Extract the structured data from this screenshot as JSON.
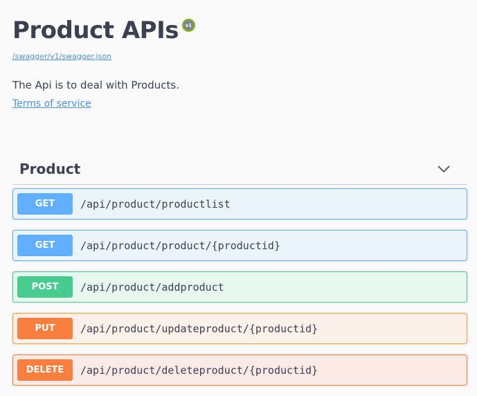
{
  "info": {
    "title": "Product APIs",
    "version_badge": "v1",
    "spec_url": "/swagger/v1/swagger.json",
    "description": "The Api is to deal with Products.",
    "terms_label": "Terms of service"
  },
  "tag": {
    "name": "Product",
    "toggle_icon": "chevron-down-icon",
    "expanded": true
  },
  "operations": [
    {
      "method": "GET",
      "path": "/api/product/productlist"
    },
    {
      "method": "GET",
      "path": "/api/product/product/{productid}"
    },
    {
      "method": "POST",
      "path": "/api/product/addproduct"
    },
    {
      "method": "PUT",
      "path": "/api/product/updateproduct/{productid}"
    },
    {
      "method": "DELETE",
      "path": "/api/product/deleteproduct/{productid}"
    }
  ],
  "colors": {
    "get": "#61affe",
    "post": "#49cc90",
    "put": "#f97f3f",
    "delete": "#f97f3f",
    "link": "#4990e2",
    "text": "#3b4151"
  }
}
